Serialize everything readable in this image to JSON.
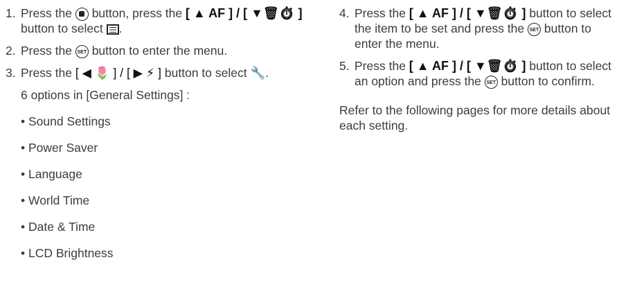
{
  "left_steps": [
    {
      "num": "1.",
      "a": "Press the",
      "b": "button, press the",
      "c": "button to select",
      "d": "."
    },
    {
      "num": "2.",
      "a": "Press the",
      "b": "button to enter the menu."
    },
    {
      "num": "3.",
      "a": "Press the",
      "b": "button to select",
      "c": "."
    }
  ],
  "buttons": {
    "up_af": "[ ▲ AF ] / [ ▼🗑⏱ ]",
    "left_right": "[ ◀ 🌷 ] / [ ▶ ⚡ ]",
    "set": "SET",
    "wrench": "🔧"
  },
  "subheading": "6 options in [General Settings] :",
  "options": [
    "• Sound Settings",
    "• Power Saver",
    "• Language",
    "• World Time",
    "• Date & Time",
    "• LCD Brightness"
  ],
  "right_steps": [
    {
      "num": "4.",
      "a": "Press the",
      "b": "button to select the item to be set and press the",
      "c": "button to enter the menu."
    },
    {
      "num": "5.",
      "a": "Press the",
      "b": "button to select an option and press the",
      "c": "button to confirm."
    }
  ],
  "refer_text": "Refer to the following pages for more details about each setting."
}
